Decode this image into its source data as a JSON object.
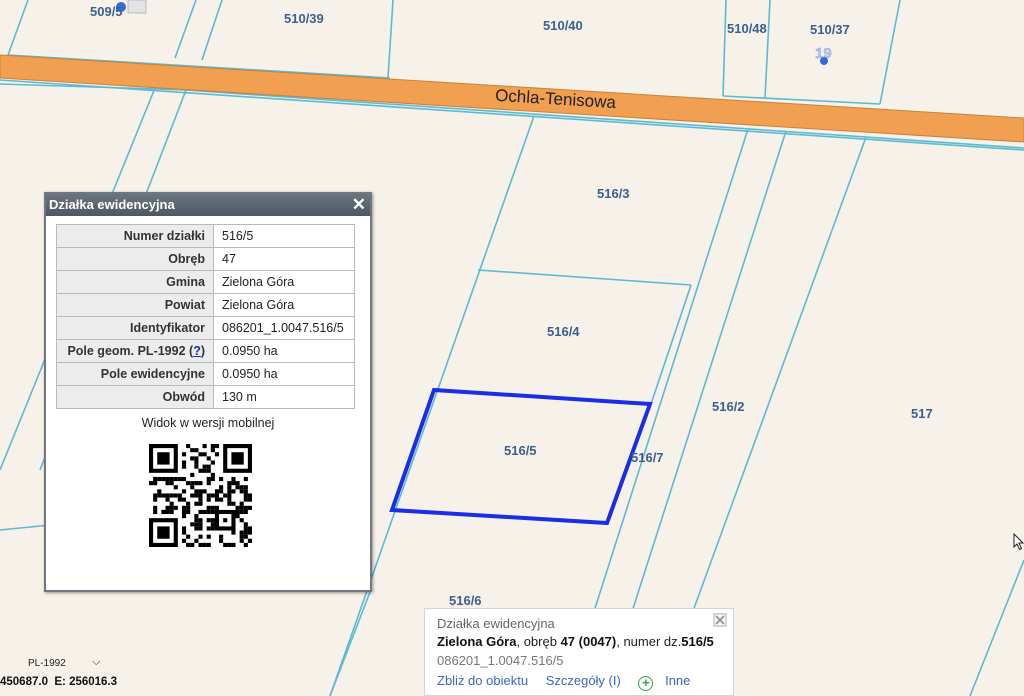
{
  "map": {
    "road_name": "Ochla-Tenisowa",
    "parcel_labels": {
      "p509": "509/5",
      "p510_39": "510/39",
      "p510_40": "510/40",
      "p510_48": "510/48",
      "p510_37": "510/37",
      "p516_3": "516/3",
      "p516_4": "516/4",
      "p516_2": "516/2",
      "p517": "517",
      "p516_5": "516/5",
      "p516_7": "516/7",
      "p516_6": "516/6"
    },
    "marker_label": "19",
    "colors": {
      "background": "#f6f2e9",
      "parcel_lines": "#5bbad3",
      "road": "#f0a050",
      "selection": "#1a2ee6",
      "label": "#3b5f8f"
    }
  },
  "popup": {
    "title": "Działka ewidencyjna",
    "close_icon": "close-icon",
    "rows": [
      {
        "key": "Numer działki",
        "value": "516/5"
      },
      {
        "key": "Obręb",
        "value": "47"
      },
      {
        "key": "Gmina",
        "value": "Zielona Góra"
      },
      {
        "key": "Powiat",
        "value": "Zielona Góra"
      },
      {
        "key": "Identyfikator",
        "value": "086201_1.0047.516/5"
      },
      {
        "key": "Pole geom. PL-1992",
        "help": "?",
        "value": "0.0950 ha"
      },
      {
        "key": "Pole ewidencyjne",
        "value": "0.0950 ha"
      },
      {
        "key": "Obwód",
        "value": "130 m"
      }
    ],
    "mobile_label": "Widok w wersji mobilnej"
  },
  "infobox": {
    "title": "Działka ewidencyjna",
    "municipality": "Zielona Góra",
    "precinct_text": ", obręb ",
    "precinct": "47 (0047)",
    "number_text": ", numer dz.",
    "number": "516/5",
    "identifier": "086201_1.0047.516/5",
    "zoom_link": "Zbliż do obiektu",
    "details_link": "Szczegóły (I)",
    "other_link": "Inne"
  },
  "coords": {
    "crs": "PL-1992",
    "x_label": "450687.0",
    "e_label": "E:",
    "e_value": "256016.3"
  }
}
